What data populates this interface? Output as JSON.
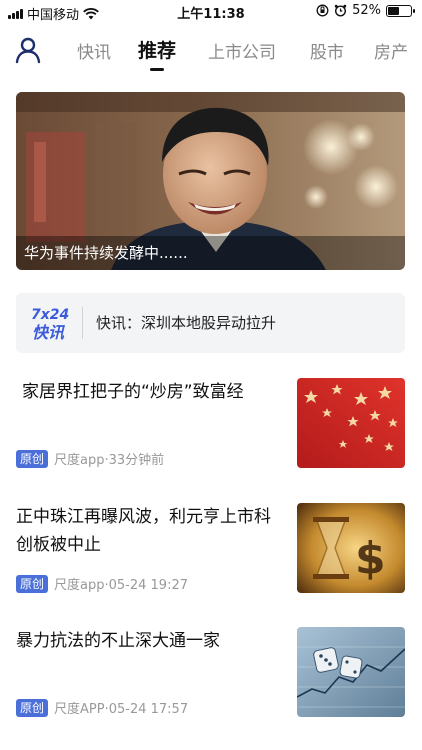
{
  "status_bar": {
    "carrier": "中国移动",
    "time": "上午11:38",
    "battery_text": "52%",
    "battery_level": 0.52
  },
  "nav": {
    "tabs": [
      {
        "label": "快讯",
        "active": false
      },
      {
        "label": "推荐",
        "active": true
      },
      {
        "label": "上市公司",
        "active": false
      },
      {
        "label": "股市",
        "active": false
      },
      {
        "label": "房产",
        "active": false
      }
    ]
  },
  "hero": {
    "caption": "华为事件持续发酵中......"
  },
  "flash": {
    "logo_top": "7x24",
    "logo_bottom": "快讯",
    "text": "快讯：深圳本地股异动拉升"
  },
  "news": [
    {
      "title": "家居界扛把子的“炒房”致富经",
      "badge": "原创",
      "meta": "尺度app·33分钟前",
      "thumb": "red-stars"
    },
    {
      "title": "正中珠江再曝风波，利元亨上市科创板被中止",
      "badge": "原创",
      "meta": "尺度app·05-24 19:27",
      "thumb": "gold-dollar-hourglass"
    },
    {
      "title": "暴力抗法的不止深大通一家",
      "badge": "原创",
      "meta": "尺度APP·05-24 17:57",
      "thumb": "dice-stock-chart"
    }
  ],
  "colors": {
    "badge": "#4a6fd8",
    "flash_logo": "#3b5bdb"
  }
}
